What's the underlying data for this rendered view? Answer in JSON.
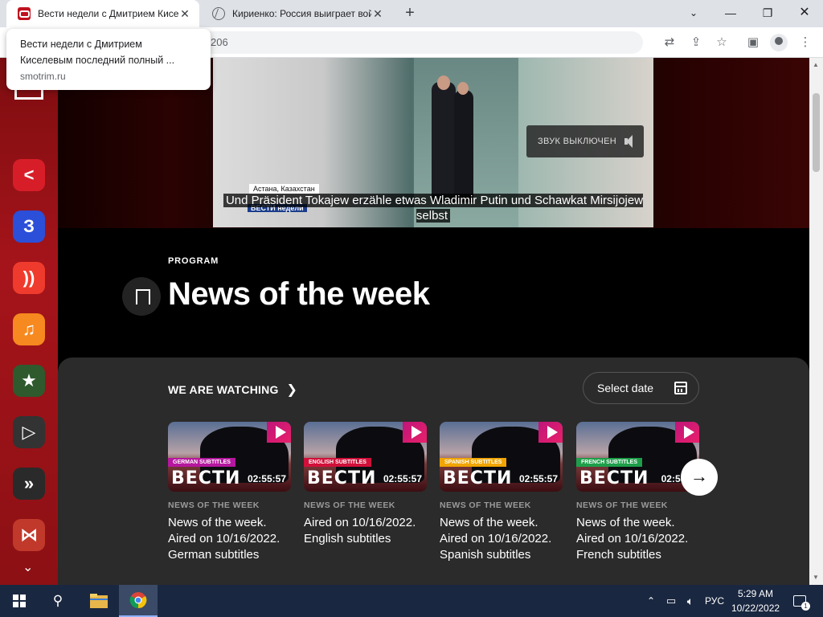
{
  "browser": {
    "tabs": [
      {
        "title": "Вести недели с Дмитрием Кисе",
        "active": true
      },
      {
        "title": "Кириенко: Россия выиграет вой",
        "active": false
      }
    ],
    "tooltip": {
      "title": "Вести недели с Дмитрием Киселевым последний полный ...",
      "domain": "smotrim.ru"
    },
    "address_fragment": "206"
  },
  "video": {
    "sound_off_label": "ЗВУК ВЫКЛЮЧЕН",
    "location_caption": "Астана, Казахстан",
    "channel_logo": "ВЕСТИ недели",
    "subtitle": "Und Präsident Tokajew erzähle etwas Wladimir Putin und Schawkat Mirsijojew selbst"
  },
  "program": {
    "label": "PROGRAM",
    "title": "News of the week"
  },
  "watching": {
    "heading": "WE ARE WATCHING",
    "select_date": "Select date",
    "cards": [
      {
        "tag": "GERMAN SUBTITLES",
        "tag_color": "#b5179e",
        "logo": "ВЕСТИ",
        "duration": "02:55:57",
        "kicker": "NEWS OF THE WEEK",
        "title": "News of the week. Aired on 10/16/2022. German subtitles"
      },
      {
        "tag": "ENGLISH SUBTITLES",
        "tag_color": "#d0103a",
        "logo": "ВЕСТИ",
        "duration": "02:55:57",
        "kicker": "NEWS OF THE WEEK",
        "title": "Aired on 10/16/2022. English subtitles"
      },
      {
        "tag": "SPANISH SUBTITLES",
        "tag_color": "#f0a500",
        "logo": "ВЕСТИ",
        "duration": "02:55:57",
        "kicker": "NEWS OF THE WEEK",
        "title": "News of the week. Aired on 10/16/2022. Spanish subtitles"
      },
      {
        "tag": "FRENCH SUBTITLES",
        "tag_color": "#1e9e4a",
        "logo": "ВЕСТИ",
        "duration": "02:55:5",
        "kicker": "NEWS OF THE WEEK",
        "title": "News of the week. Aired on 10/16/2022. French subtitles"
      }
    ]
  },
  "sidebar_apps": [
    {
      "icon": "smotrim-icon",
      "color": "#d71e28"
    },
    {
      "icon": "vesti-icon",
      "color": "#2b4fd8"
    },
    {
      "icon": "radio-icon",
      "color": "#ef3b2d"
    },
    {
      "icon": "music-icon",
      "color": "#f6891f"
    },
    {
      "icon": "star-icon",
      "color": "#2e5a2e"
    },
    {
      "icon": "play-icon",
      "color": "#333333"
    },
    {
      "icon": "arrows-icon",
      "color": "#2a2a2a"
    },
    {
      "icon": "bowtie-icon",
      "color": "#c0392b"
    }
  ],
  "taskbar": {
    "language": "РУС",
    "time": "5:29 AM",
    "date": "10/22/2022",
    "notifications": "1"
  }
}
